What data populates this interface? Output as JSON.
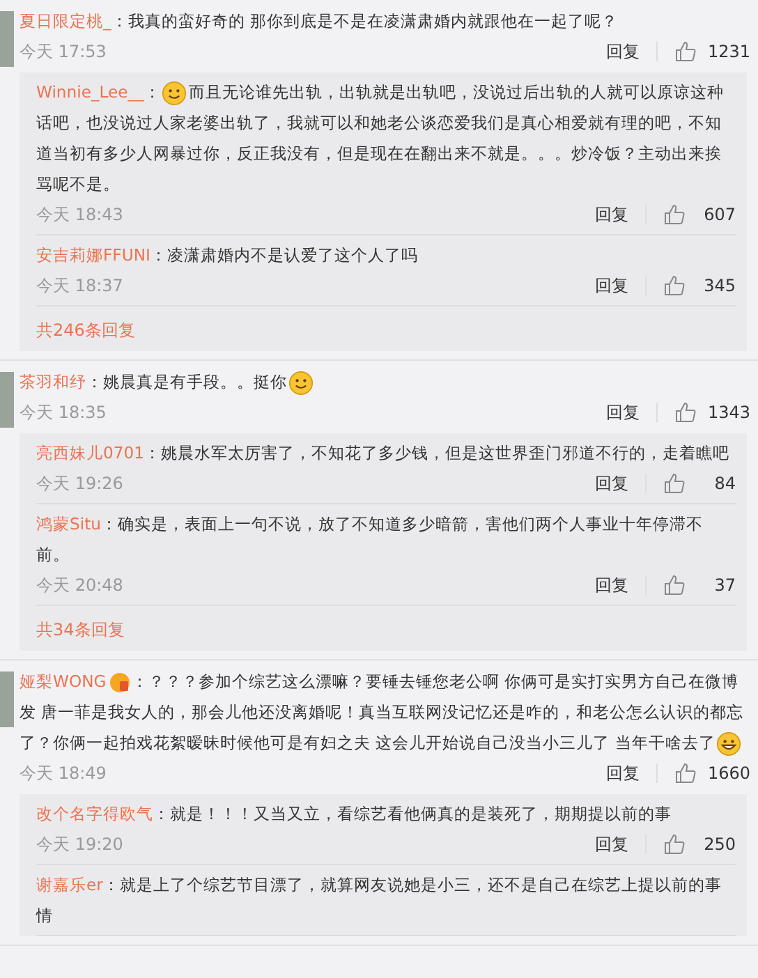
{
  "comments": [
    {
      "author": "夏日限定桃_",
      "text": "：我真的蛮好奇的 那你到底是不是在凌潇肃婚内就跟他在一起了呢？",
      "badge": false,
      "emoji_start": false,
      "emoji_end": false,
      "time": "今天 17:53",
      "reply_label": "回复",
      "likes": "1231",
      "replies": [
        {
          "author": "Winnie_Lee__",
          "text": "而且无论谁先出轨，出轨就是出轨吧，没说过后出轨的人就可以原谅这种话吧，也没说过人家老婆出轨了，我就可以和她老公谈恋爱我们是真心相爱就有理的吧，不知道当初有多少人网暴过你，反正我没有，但是现在在翻出来不就是。。。炒冷饭？主动出来挨骂呢不是。",
          "colon": "：",
          "emoji_start": true,
          "emoji_end": false,
          "time": "今天 18:43",
          "reply_label": "回复",
          "likes": "607"
        },
        {
          "author": "安吉莉娜FFUNI",
          "text": "：凌潇肃婚内不是认爱了这个人了吗",
          "emoji_start": false,
          "emoji_end": false,
          "time": "今天 18:37",
          "reply_label": "回复",
          "likes": "345"
        }
      ],
      "more_replies": "共246条回复"
    },
    {
      "author": "茶羽和纾",
      "text": "：姚晨真是有手段。。挺你",
      "badge": false,
      "emoji_start": false,
      "emoji_end": true,
      "time": "今天 18:35",
      "reply_label": "回复",
      "likes": "1343",
      "replies": [
        {
          "author": "亮西妹儿0701",
          "text": "：姚晨水军太厉害了，不知花了多少钱，但是这世界歪门邪道不行的，走着瞧吧",
          "emoji_start": false,
          "emoji_end": false,
          "time": "今天 19:26",
          "reply_label": "回复",
          "likes": "84"
        },
        {
          "author": "鸿蒙Situ",
          "text": "：确实是，表面上一句不说，放了不知道多少暗箭，害他们两个人事业十年停滞不前。",
          "emoji_start": false,
          "emoji_end": false,
          "time": "今天 20:48",
          "reply_label": "回复",
          "likes": "37"
        }
      ],
      "more_replies": "共34条回复"
    },
    {
      "author": "娅梨WONG",
      "text": "：？？？参加个综艺这么漂嘛？要锤去锤您老公啊 你俩可是实打实男方自己在微博发 唐一菲是我女人的，那会儿他还没离婚呢！真当互联网没记忆还是咋的，和老公怎么认识的都忘了？你俩一起拍戏花絮暧昧时候他可是有妇之夫 这会儿开始说自己没当小三儿了 当年干啥去了",
      "badge": true,
      "emoji_start": false,
      "emoji_end": true,
      "time": "今天 18:49",
      "reply_label": "回复",
      "likes": "1660",
      "replies": [
        {
          "author": "改个名字得欧气",
          "text": "：就是！！！又当又立，看综艺看他俩真的是装死了，期期提以前的事",
          "emoji_start": false,
          "emoji_end": false,
          "time": "今天 19:20",
          "reply_label": "回复",
          "likes": "250"
        },
        {
          "author": "谢嘉乐er",
          "text": "：就是上了个综艺节目漂了，就算网友说她是小三，还不是自己在综艺上提以前的事情",
          "emoji_start": false,
          "emoji_end": false
        }
      ]
    }
  ]
}
